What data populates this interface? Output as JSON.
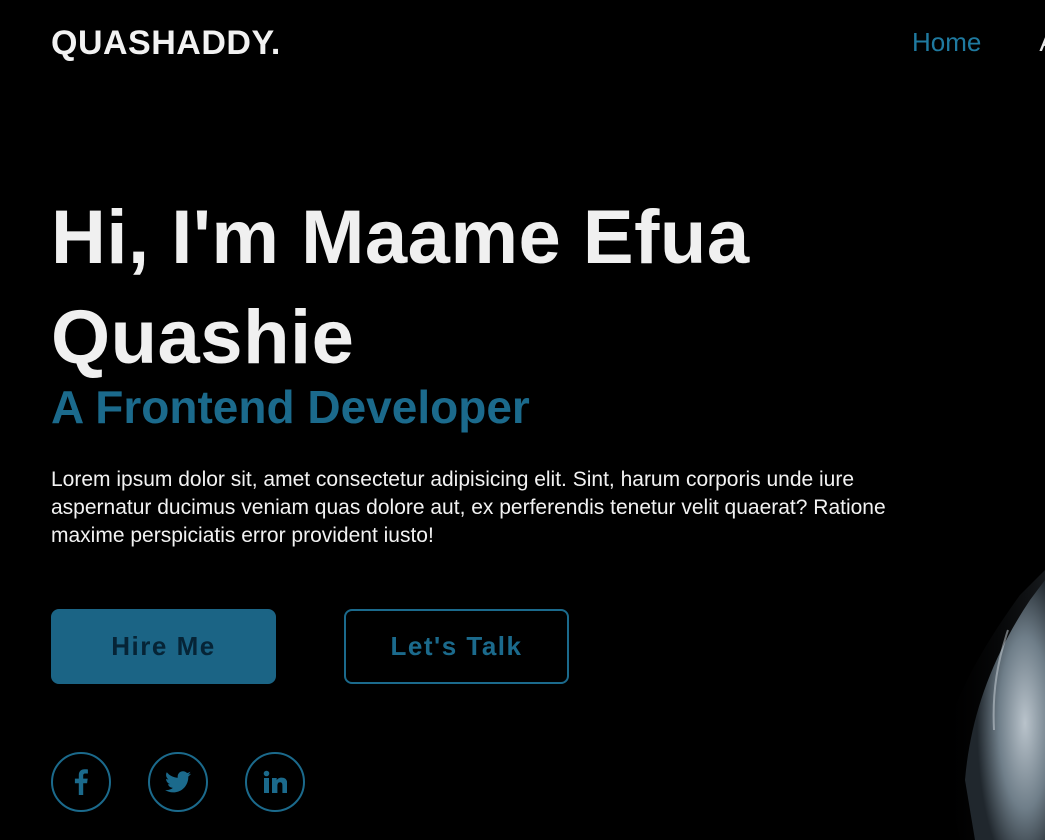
{
  "brand": {
    "logo": "QUASHADDY."
  },
  "nav": {
    "items": [
      {
        "label": "Home"
      },
      {
        "label": "A"
      }
    ]
  },
  "hero": {
    "title": "Hi, I'm Maame Efua Quashie",
    "subtitle": "A Frontend Developer",
    "description": "Lorem ipsum dolor sit, amet consectetur adipisicing elit. Sint, harum corporis unde iure aspernatur ducimus veniam quas dolore aut, ex perferendis tenetur velit quaerat? Ratione maxime perspiciatis error provident iusto!",
    "primary_button": "Hire Me",
    "secondary_button": "Let's Talk"
  },
  "social": [
    {
      "icon": "facebook-icon"
    },
    {
      "icon": "twitter-icon"
    },
    {
      "icon": "linkedin-icon"
    }
  ],
  "colors": {
    "background": "#000000",
    "accent": "#1b6a8c",
    "primary_button_bg": "#1b6485",
    "text": "#f0f0f0"
  }
}
